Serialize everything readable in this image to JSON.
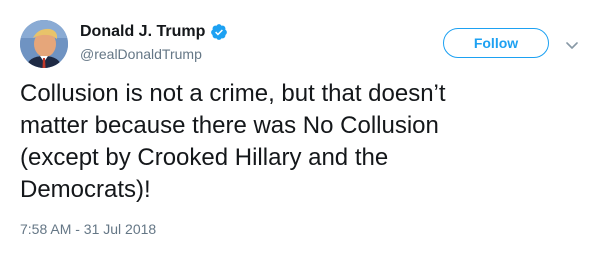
{
  "author": {
    "display_name": "Donald J. Trump",
    "handle": "@realDonaldTrump",
    "verified": true,
    "avatar_icon": "profile-photo-avatar",
    "verified_icon": "verified-badge-icon"
  },
  "actions": {
    "follow_label": "Follow",
    "menu_icon": "chevron-down-icon"
  },
  "tweet": {
    "lines": [
      "Collusion is not a crime, but that doesn’t",
      "matter because there was No Collusion",
      "(except by Crooked Hillary and the",
      "Democrats)!"
    ],
    "timestamp": "7:58 AM - 31 Jul 2018"
  },
  "colors": {
    "accent": "#1da1f2",
    "text_primary": "#14171a",
    "text_secondary": "#657786"
  }
}
